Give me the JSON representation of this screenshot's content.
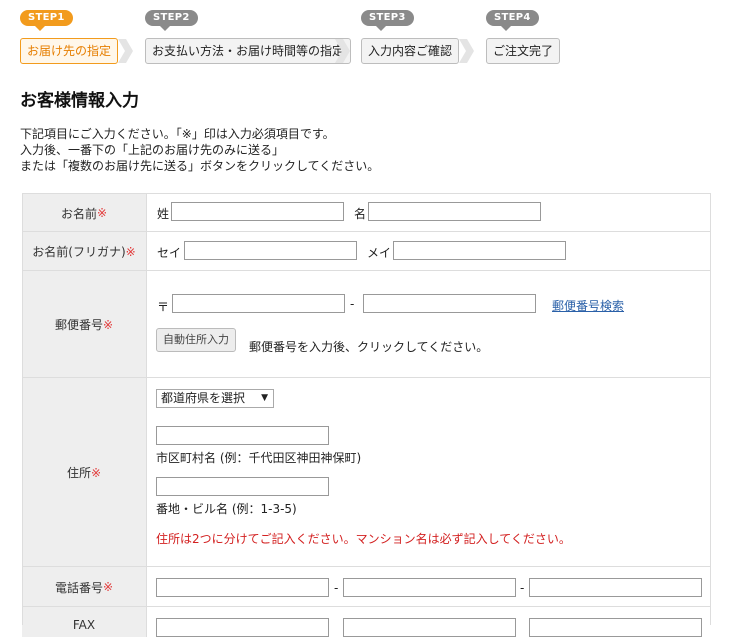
{
  "steps": [
    {
      "badge": "STEP1",
      "label": "お届け先の指定",
      "active": true
    },
    {
      "badge": "STEP2",
      "label": "お支払い方法・お届け時間等の指定",
      "active": false
    },
    {
      "badge": "STEP3",
      "label": "入力内容ご確認",
      "active": false
    },
    {
      "badge": "STEP4",
      "label": "ご注文完了",
      "active": false
    }
  ],
  "page_title": "お客様情報入力",
  "intro": [
    "下記項目にご入力ください。「※」印は入力必須項目です。",
    "入力後、一番下の「上記のお届け先のみに送る」",
    "または「複数のお届け先に送る」ボタンをクリックしてください。"
  ],
  "required_mark": "※",
  "form": {
    "name": {
      "label": "お名前",
      "sei": "姓",
      "mei": "名"
    },
    "kana": {
      "label": "お名前(フリガナ)",
      "sei": "セイ",
      "mei": "メイ"
    },
    "postal": {
      "label": "郵便番号",
      "prefix": "〒",
      "dash": "-",
      "search_link": "郵便番号検索",
      "auto_button": "自動住所入力",
      "hint": "郵便番号を入力後、クリックしてください。"
    },
    "address": {
      "label": "住所",
      "pref_select": "都道府県を選択",
      "city_hint": "市区町村名 (例：千代田区神田神保町)",
      "street_hint": "番地・ビル名 (例：1-3-5)",
      "warning": "住所は2つに分けてご記入ください。マンション名は必ず記入してください。"
    },
    "phone": {
      "label": "電話番号",
      "dash": "-"
    },
    "fax": {
      "label": "FAX",
      "dash": "-"
    }
  }
}
